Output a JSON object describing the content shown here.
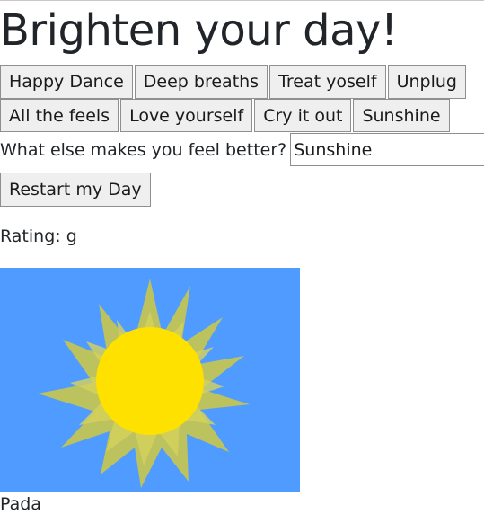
{
  "header": {
    "title": "Brighten your day!"
  },
  "mood_buttons": [
    {
      "label": "Happy Dance"
    },
    {
      "label": "Deep breaths"
    },
    {
      "label": "Treat yoself"
    },
    {
      "label": "Unplug"
    },
    {
      "label": "All the feels"
    },
    {
      "label": "Love yourself"
    },
    {
      "label": "Cry it out"
    },
    {
      "label": "Sunshine"
    }
  ],
  "question": {
    "label": "What else makes you feel better?",
    "value": "Sunshine"
  },
  "restart": {
    "label": "Restart my Day"
  },
  "rating": {
    "text": "Rating: g"
  },
  "gif": {
    "description": "sunshine-gif",
    "colors": {
      "sky": "#4f9bff",
      "sun": "#ffe100",
      "rays": "#c7c64d"
    }
  },
  "caption": {
    "text": "Pada"
  }
}
